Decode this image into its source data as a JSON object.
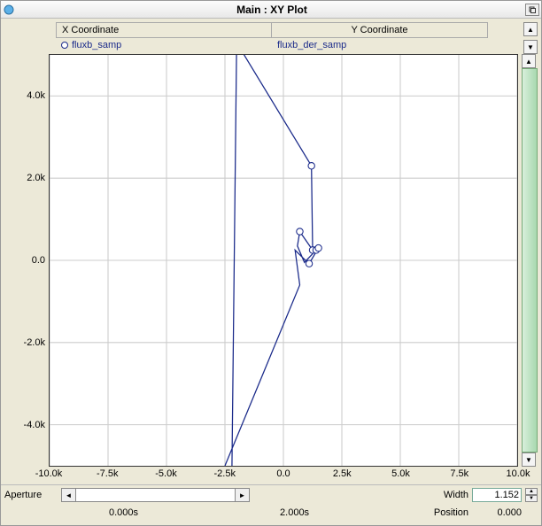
{
  "title": "Main : XY Plot",
  "legend": {
    "x_header": "X Coordinate",
    "y_header": "Y Coordinate",
    "x_series": "fluxb_samp",
    "y_series": "fluxb_der_samp"
  },
  "bottom": {
    "aperture_label": "Aperture",
    "width_label": "Width",
    "width_value": "1.152",
    "t_start": "0.000s",
    "t_end": "2.000s",
    "position_label": "Position",
    "position_value": "0.000"
  },
  "chart_data": {
    "type": "line",
    "title": "",
    "xlabel": "",
    "ylabel": "",
    "xlim": [
      -10000,
      10000
    ],
    "ylim": [
      -5000,
      5000
    ],
    "xticks": [
      -10000,
      -7500,
      -5000,
      -2500,
      0,
      2500,
      5000,
      7500,
      10000
    ],
    "xtick_labels": [
      "-10.0k",
      "-7.5k",
      "-5.0k",
      "-2.5k",
      "0.0",
      "2.5k",
      "5.0k",
      "7.5k",
      "10.0k"
    ],
    "yticks": [
      -4000,
      -2000,
      0,
      2000,
      4000
    ],
    "ytick_labels": [
      "-4.0k",
      "-2.0k",
      "0.0",
      "2.0k",
      "4.0k"
    ],
    "series": [
      {
        "name": "fluxb_samp vs fluxb_der_samp",
        "x": [
          -2200,
          -2000,
          1200,
          1250,
          700,
          600,
          900,
          1400,
          1500,
          1100,
          800,
          500,
          700,
          -2500
        ],
        "y": [
          -5000,
          5300,
          2300,
          250,
          700,
          350,
          -50,
          250,
          300,
          -80,
          80,
          250,
          -600,
          -5000
        ],
        "markers_at": [
          2,
          4,
          3,
          7,
          8,
          9
        ]
      }
    ]
  }
}
